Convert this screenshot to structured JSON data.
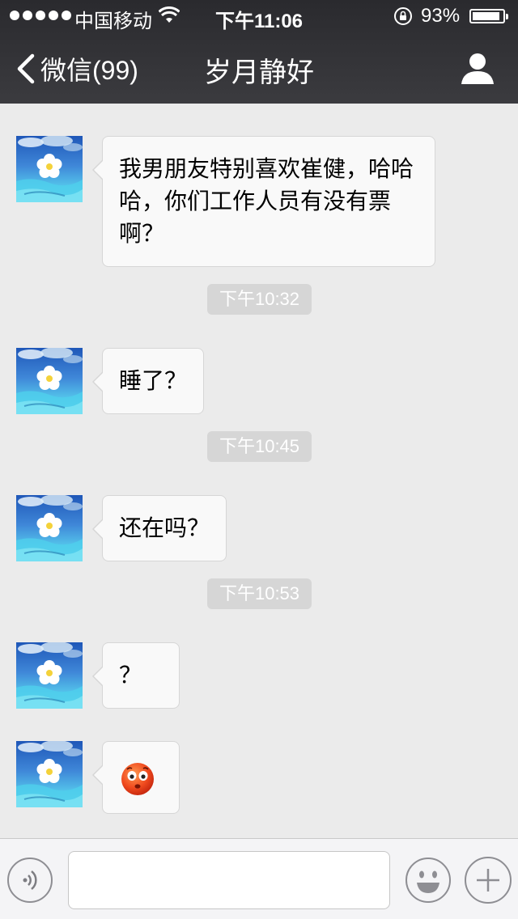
{
  "status_bar": {
    "carrier": "中国移动",
    "time": "下午11:06",
    "battery_percent": "93%",
    "battery_level": 0.93,
    "signal_dots": 5
  },
  "nav": {
    "back_label": "微信(99)",
    "title": "岁月静好",
    "profile_icon": "person-icon"
  },
  "messages": [
    {
      "text": "我男朋友特别喜欢崔健，哈哈哈，你们工作人员有没有票啊？"
    },
    {
      "time": "下午10:32"
    },
    {
      "text": "睡了？"
    },
    {
      "time": "下午10:45"
    },
    {
      "text": "还在吗？"
    },
    {
      "time": "下午10:53"
    },
    {
      "text": "？"
    },
    {
      "emoji": "embarrassed-face-emoji"
    }
  ],
  "input_bar": {
    "voice_icon": "voice-icon",
    "input_value": "",
    "emoji_icon": "smiley-icon",
    "plus_icon": "plus-icon"
  },
  "colors": {
    "background": "#ebebeb",
    "header": "#333337",
    "bubble": "#f9f9f9",
    "timestamp": "#d6d6d6"
  }
}
